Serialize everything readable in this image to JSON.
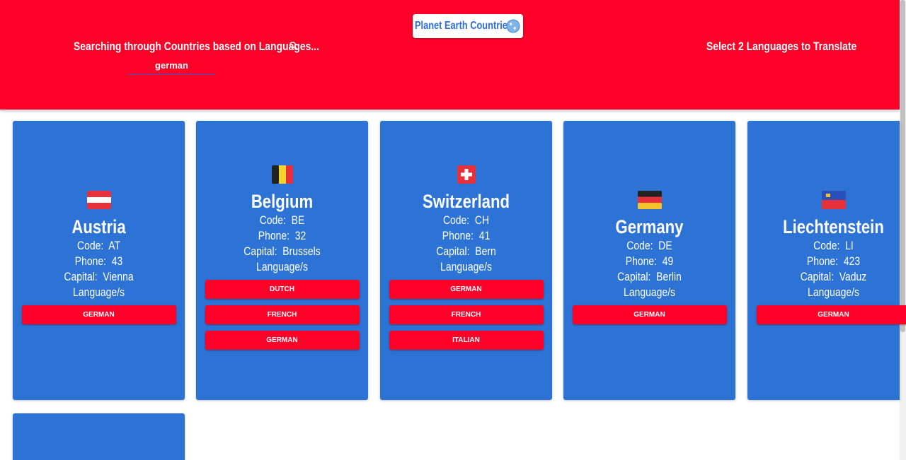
{
  "header": {
    "search_label": "Searching through Countries based on Languages...",
    "search_value": "german",
    "logo_text": "Planet Earth Countries",
    "translate_label": "Select 2 Languages to Translate"
  },
  "labels": {
    "code": "Code:",
    "phone": "Phone:",
    "capital": "Capital:",
    "languages": "Language/s"
  },
  "countries": [
    {
      "name": "Austria",
      "code": "AT",
      "phone": "43",
      "capital": "Vienna",
      "languages": [
        "GERMAN"
      ],
      "flag": "austria-flag"
    },
    {
      "name": "Belgium",
      "code": "BE",
      "phone": "32",
      "capital": "Brussels",
      "languages": [
        "DUTCH",
        "FRENCH",
        "GERMAN"
      ],
      "flag": "belgium-flag"
    },
    {
      "name": "Switzerland",
      "code": "CH",
      "phone": "41",
      "capital": "Bern",
      "languages": [
        "GERMAN",
        "FRENCH",
        "ITALIAN"
      ],
      "flag": "switzerland-flag"
    },
    {
      "name": "Germany",
      "code": "DE",
      "phone": "49",
      "capital": "Berlin",
      "languages": [
        "GERMAN"
      ],
      "flag": "germany-flag"
    },
    {
      "name": "Liechtenstein",
      "code": "LI",
      "phone": "423",
      "capital": "Vaduz",
      "languages": [
        "GERMAN"
      ],
      "flag": "liechtenstein-flag"
    }
  ],
  "colors": {
    "header_bg": "#ff0128",
    "card_bg": "#2d73d6",
    "button_bg": "#ff0128"
  }
}
